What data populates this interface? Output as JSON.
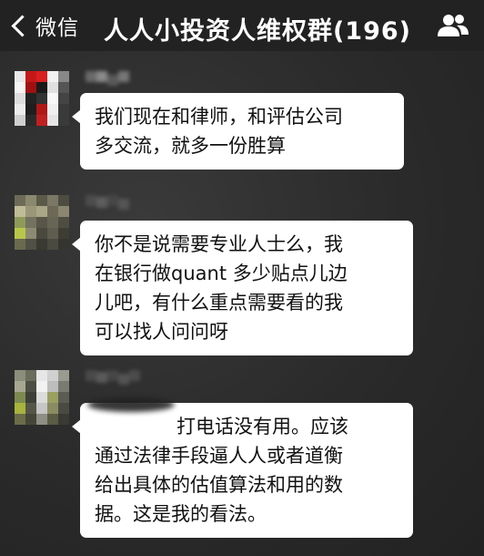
{
  "header": {
    "back_label": "微信",
    "title": "人人小投资人维权群(196)",
    "back_icon": "chevron-left-icon",
    "members_icon": "group-members-icon"
  },
  "messages": [
    {
      "lines": [
        "我们现在和律师，和评估公司",
        "多交流，就多一份胜算"
      ]
    },
    {
      "lines": [
        "你不是说需要专业人士么，我",
        "在银行做quant 多少贴点儿边",
        "儿吧，有什么重点需要看的我",
        "可以找人问问呀"
      ]
    },
    {
      "lines": [
        "打电话没有用。应该",
        "通过法律手段逼人人或者道衡",
        "给出具体的估值算法和用的数",
        "据。这是我的看法。"
      ]
    }
  ],
  "colors": {
    "header_bg": "#222222",
    "chat_bg": "#2b2b2b",
    "bubble_bg": "#ffffff",
    "text": "#111111"
  }
}
